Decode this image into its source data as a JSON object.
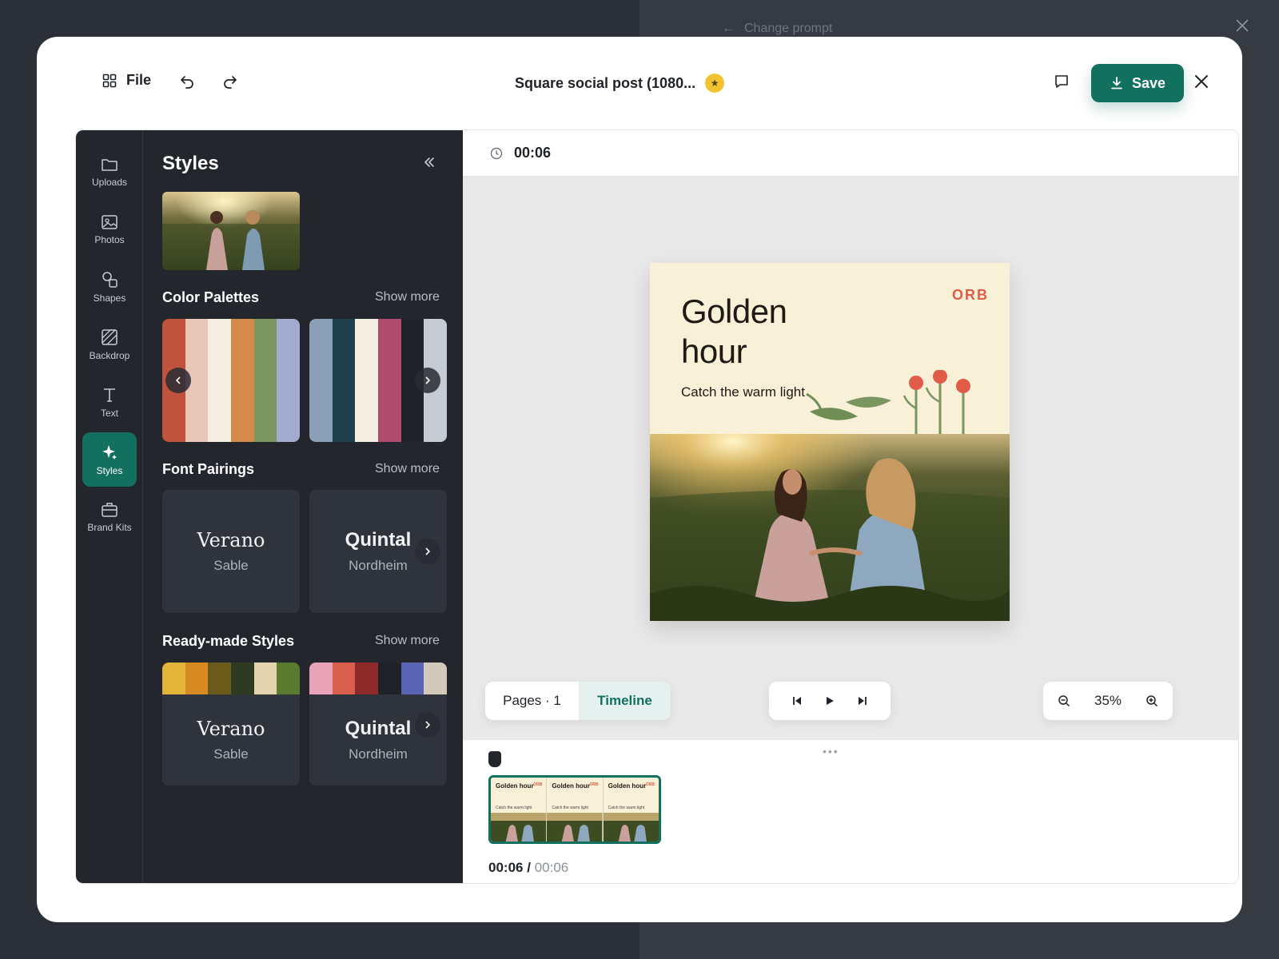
{
  "background": {
    "change_prompt": "Change prompt"
  },
  "header": {
    "file_label": "File",
    "doc_title": "Square social post (1080...",
    "save_label": "Save"
  },
  "rail": {
    "items": [
      {
        "label": "Uploads",
        "icon": "folder-icon"
      },
      {
        "label": "Photos",
        "icon": "image-icon"
      },
      {
        "label": "Shapes",
        "icon": "shapes-icon"
      },
      {
        "label": "Backdrop",
        "icon": "backdrop-icon"
      },
      {
        "label": "Text",
        "icon": "text-icon"
      },
      {
        "label": "Styles",
        "icon": "sparkle-icon",
        "active": true
      },
      {
        "label": "Brand Kits",
        "icon": "briefcase-icon"
      }
    ]
  },
  "panel": {
    "title": "Styles",
    "color_palettes": {
      "title": "Color Palettes",
      "show_more": "Show more",
      "palettes": [
        [
          "#c0533d",
          "#e8c6b8",
          "#f3ede2",
          "#d68a4c",
          "#7b9563",
          "#a3acd0"
        ],
        [
          "#8aa0b6",
          "#1e3f4c",
          "#f3ede2",
          "#b04d6e",
          "#1f2226",
          "#c4ccd4"
        ]
      ]
    },
    "font_pairings": {
      "title": "Font Pairings",
      "show_more": "Show more",
      "cards": [
        {
          "main": "Verano",
          "sub": "Sable"
        },
        {
          "main": "Quintal",
          "sub": "Nordheim"
        }
      ]
    },
    "ready_made": {
      "title": "Ready-made Styles",
      "show_more": "Show more",
      "cards": [
        {
          "main": "Verano",
          "sub": "Sable",
          "colors": [
            "#e3b43a",
            "#d88a22",
            "#6b5b1a",
            "#2f3a22",
            "#e4d4ae",
            "#5a7a30"
          ]
        },
        {
          "main": "Quintal",
          "sub": "Nordheim",
          "colors": [
            "#e9a3b8",
            "#d85e4d",
            "#8e2a2a",
            "#1f2226",
            "#5b63b5",
            "#d2c9bb"
          ]
        }
      ]
    }
  },
  "canvas": {
    "duration": "00:06",
    "artboard": {
      "title_line1": "Golden",
      "title_line2": "hour",
      "subtitle": "Catch the warm light",
      "brand": "ORB"
    },
    "pages_label": "Pages · 1",
    "timeline_label": "Timeline",
    "zoom": "35%"
  },
  "timeline": {
    "clip_thumbs": [
      {
        "title": "Golden hour",
        "brand": "ORB",
        "sub": "Catch the warm light"
      },
      {
        "title": "Golden hour",
        "brand": "ORB",
        "sub": "Catch the warm light"
      },
      {
        "title": "Golden hour",
        "brand": "ORB",
        "sub": "Catch the warm light"
      }
    ],
    "current_time": "00:06",
    "separator": "/",
    "total_time": "00:06"
  }
}
